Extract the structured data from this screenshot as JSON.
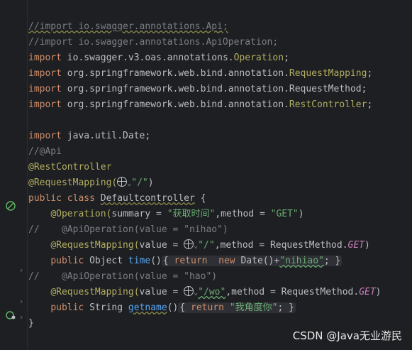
{
  "gutter_icons": [
    "bean-icon",
    "bean-icon"
  ],
  "code": {
    "l1": "//import io.swagger.annotations.Api;",
    "l2": "//import io.swagger.annotations.ApiOperation;",
    "l3_kw": "import",
    "l3_pkg": " io.swagger.v3.oas.annotations.",
    "l3_cls": "Operation",
    "l4_kw": "import",
    "l4_pkg": " org.springframework.web.bind.annotation.",
    "l4_cls": "RequestMapping",
    "l5_kw": "import",
    "l5_pkg": " org.springframework.web.bind.annotation.RequestMethod;",
    "l6_kw": "import",
    "l6_pkg": " org.springframework.web.bind.annotation.",
    "l6_cls": "RestController",
    "l8_kw": "import",
    "l8_pkg": " java.util.Date;",
    "l9": "//@Api",
    "l10": "@RestController",
    "l11_an": "@RequestMapping(",
    "l11_str": "\"/\"",
    "l12_kw": "public class",
    "l12_name": "Defaultcontroller",
    "l13_an": "@Operation(",
    "l13_a": "summary = ",
    "l13_s1": "\"获取时间\"",
    "l13_b": ",method = ",
    "l13_s2": "\"GET\"",
    "l14": "//    @ApiOperation(value = \"nihao\")",
    "l15_an": "@RequestMapping(",
    "l15_a": "value = ",
    "l15_s": "\"/\"",
    "l15_b": ",method = RequestMethod.",
    "l15_it": "GET",
    "l16_kw": "public",
    "l16_type": "Object",
    "l16_fn": "time",
    "l16_ret": "return",
    "l16_new": "new",
    "l16_date": "Date()+",
    "l16_str": "\"nihiao\"",
    "l17": "//    @ApiOperation(value = \"hao\")",
    "l18_an": "@RequestMapping(",
    "l18_a": "value = ",
    "l18_s": "\"/wo\"",
    "l18_b": ",method = RequestMethod.",
    "l18_it": "GET",
    "l19_kw": "public",
    "l19_type": "String",
    "l19_fn": "getname",
    "l19_ret": "return",
    "l19_str": "\"我角度你\"",
    "l20": "}"
  },
  "watermark": "CSDN @Java无业游民"
}
